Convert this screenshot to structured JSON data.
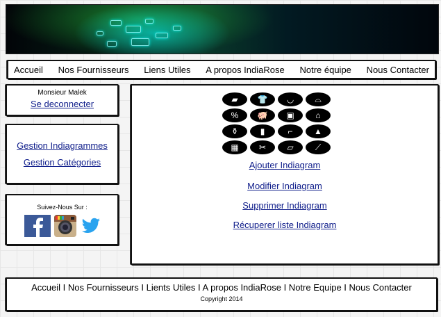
{
  "nav": {
    "items": [
      "Accueil",
      "Nos Fournisseurs",
      "Liens Utiles",
      "A propos IndiaRose",
      "Notre équipe",
      "Nous Contacter"
    ]
  },
  "user": {
    "name": "Monsieur Malek",
    "logout_label": "Se deconnecter"
  },
  "gestion": {
    "items": [
      "Gestion Indiagrammes",
      "Gestion Catégories"
    ]
  },
  "social": {
    "label": "Suivez-Nous Sur :",
    "icons": [
      "facebook-icon",
      "instagram-icon",
      "twitter-icon"
    ]
  },
  "main": {
    "category_icons": [
      "soap-icon",
      "shirt-icon",
      "basin-icon",
      "basket-icon",
      "percent-icon",
      "pig-icon",
      "box-icon",
      "house-icon",
      "bottle-icon",
      "bottle-icon",
      "shoe-icon",
      "cone-icon",
      "book-icon",
      "scissors-icon",
      "paper-icon",
      "broom-icon"
    ],
    "actions": [
      "Ajouter Indiagram",
      "Modifier Indiagram",
      "Supprimer Indiagram",
      "Récuperer liste Indiagram"
    ]
  },
  "footer": {
    "links": "Accueil I Nos Fournisseurs I Lients Utiles I A propos IndiaRose I Notre Equipe I Nous Contacter",
    "copyright": "Copyright 2014"
  },
  "colors": {
    "link": "#12208c",
    "border": "#111111"
  }
}
